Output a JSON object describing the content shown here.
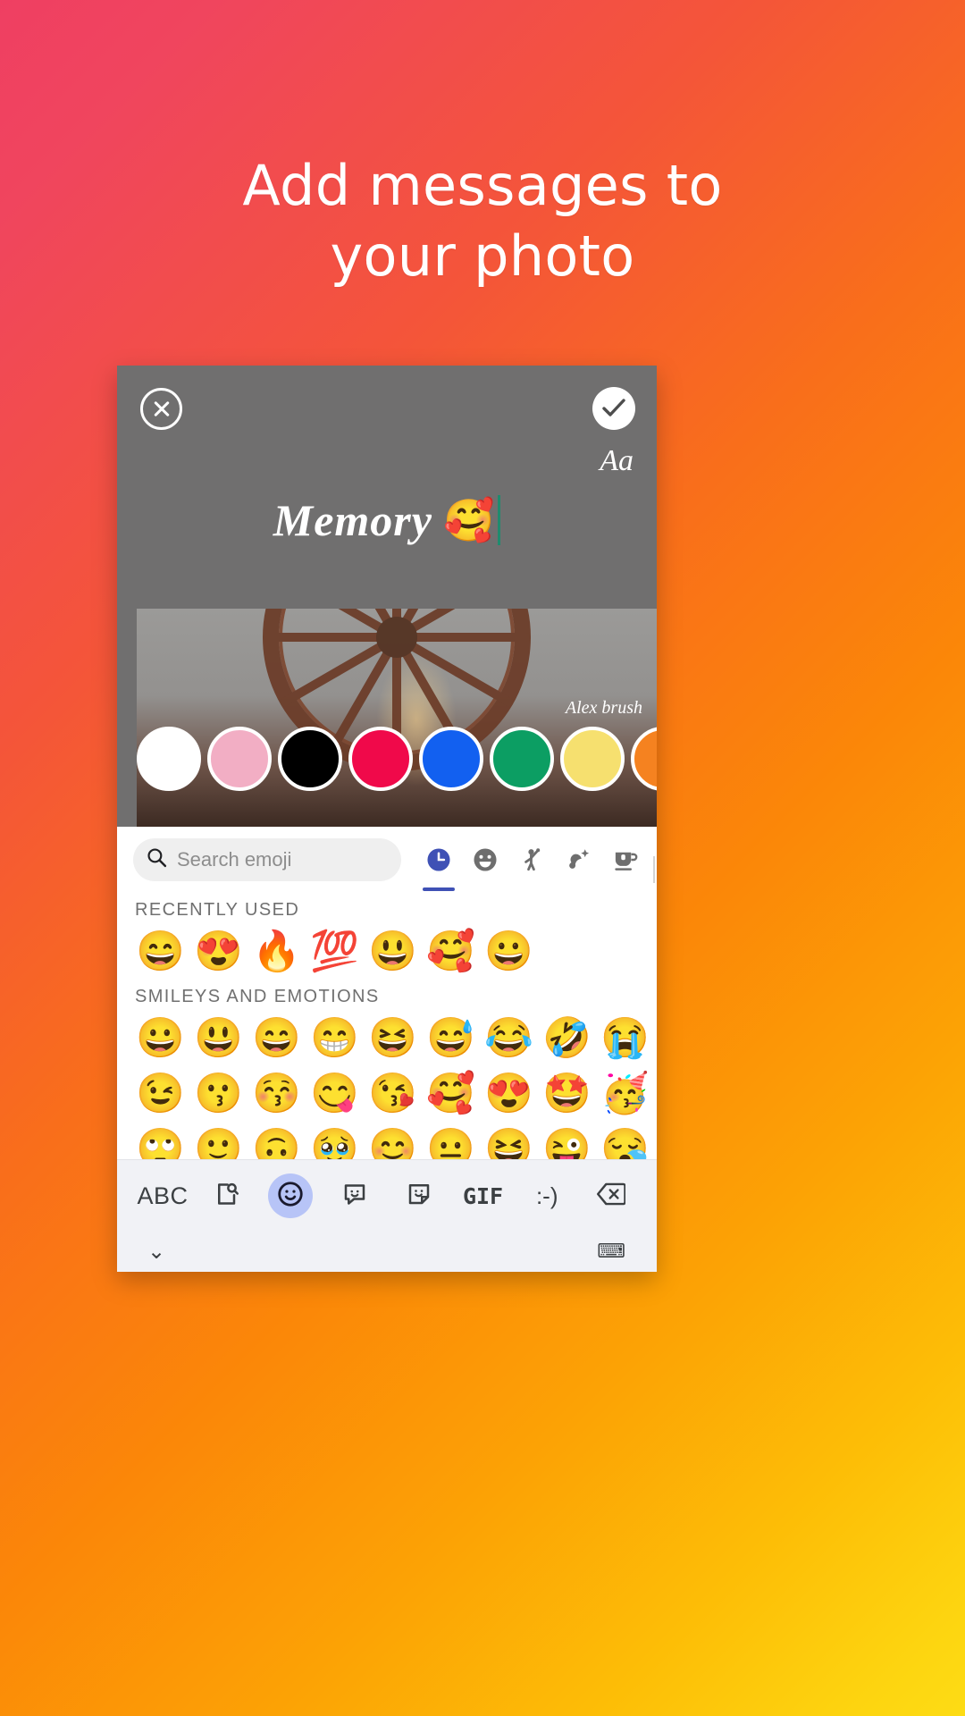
{
  "headline": {
    "line1": "Add messages to",
    "line2": "your photo"
  },
  "editor": {
    "close_label": "close-icon",
    "done_label": "done-check-icon",
    "font_toggle_label": "Aa",
    "text_value": "Memory",
    "text_emoji": "🥰",
    "font_name": "Alex brush",
    "caret_color": "#1f8b6e",
    "overlay_color": "#706f6f",
    "colors": [
      {
        "name": "white",
        "hex": "#ffffff"
      },
      {
        "name": "pink",
        "hex": "#f2aec4"
      },
      {
        "name": "black",
        "hex": "#000000"
      },
      {
        "name": "crimson",
        "hex": "#f0094a"
      },
      {
        "name": "blue",
        "hex": "#1260f0"
      },
      {
        "name": "green",
        "hex": "#0c9e63"
      },
      {
        "name": "yellow",
        "hex": "#f6e06f"
      },
      {
        "name": "orange",
        "hex": "#f58220"
      }
    ]
  },
  "keyboard": {
    "search": {
      "placeholder": "Search emoji",
      "value": "",
      "icon": "search-icon"
    },
    "categories": [
      {
        "name": "recent",
        "icon": "clock-icon",
        "active": true
      },
      {
        "name": "smileys",
        "icon": "smiley-icon",
        "active": false
      },
      {
        "name": "people",
        "icon": "person-waving-icon",
        "active": false
      },
      {
        "name": "nature",
        "icon": "plant-sparkle-icon",
        "active": false
      },
      {
        "name": "food",
        "icon": "cup-icon",
        "active": false
      }
    ],
    "active_tab_color": "#3f51b5",
    "sections": [
      {
        "title": "RECENTLY USED",
        "emojis": [
          "😄",
          "😍",
          "🔥",
          "💯",
          "😃",
          "🥰",
          "😀"
        ]
      },
      {
        "title": "SMILEYS AND EMOTIONS",
        "emojis": [
          "😀",
          "😃",
          "😄",
          "😁",
          "😆",
          "😅",
          "😂",
          "🤣",
          "😭",
          "😉",
          "😗",
          "😚",
          "😋",
          "😘",
          "🥰",
          "😍",
          "🤩",
          "🥳",
          "🙄",
          "🙂",
          "🙃",
          "🥹",
          "😊",
          "😐",
          "😆",
          "😜",
          "😪"
        ]
      }
    ],
    "toolbar": [
      {
        "name": "abc-button",
        "label": "ABC",
        "type": "text",
        "active": false
      },
      {
        "name": "search-doc-button",
        "label": "",
        "type": "icon",
        "active": false
      },
      {
        "name": "emoji-button",
        "label": "",
        "type": "icon",
        "active": true
      },
      {
        "name": "sticker-chat-button",
        "label": "",
        "type": "icon",
        "active": false
      },
      {
        "name": "sticker-button",
        "label": "",
        "type": "icon",
        "active": false
      },
      {
        "name": "gif-button",
        "label": "GIF",
        "type": "text",
        "active": false
      },
      {
        "name": "emoticon-button",
        "label": ":-)",
        "type": "text",
        "active": false
      },
      {
        "name": "backspace-button",
        "label": "",
        "type": "icon",
        "active": false
      }
    ],
    "footer": {
      "collapse": "⌄",
      "keyboard_switch": "⌨"
    }
  }
}
